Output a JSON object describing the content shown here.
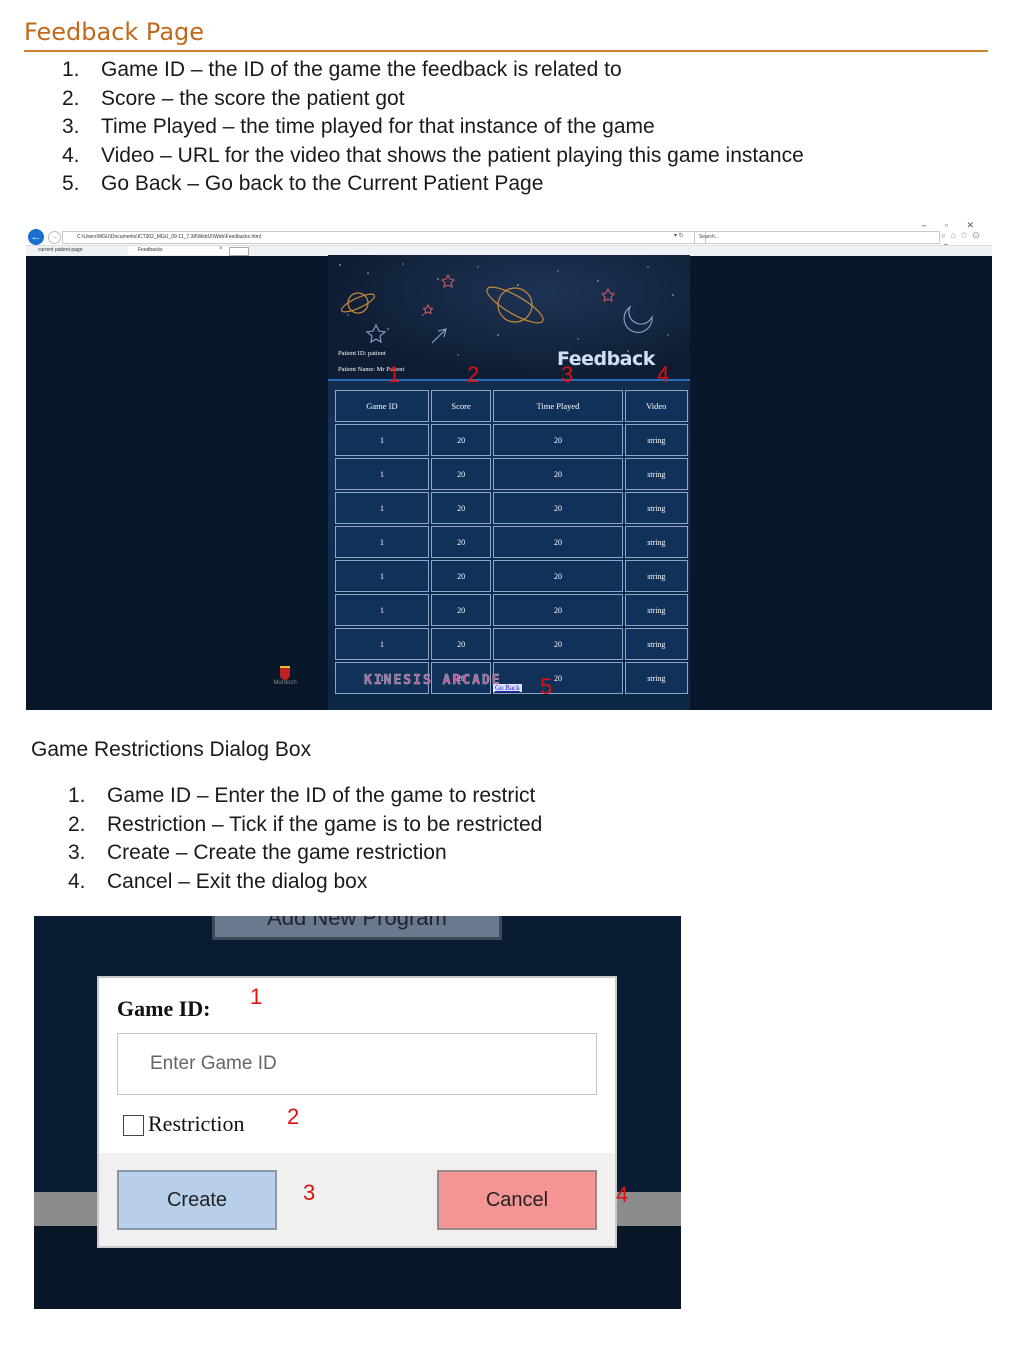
{
  "section1": {
    "title": "Feedback Page",
    "items": [
      {
        "num": "1.",
        "text": "Game ID – the ID of the game the feedback is related to"
      },
      {
        "num": "2.",
        "text": "Score – the score the patient got"
      },
      {
        "num": "3.",
        "text": "Time Played – the time played for that instance of the game"
      },
      {
        "num": "4.",
        "text": "Video – URL for the video that shows the patient playing this game instance"
      },
      {
        "num": "5.",
        "text": "Go Back – Go back to the Current Patient Page"
      }
    ]
  },
  "browser": {
    "address": "C:\\Users\\MGU\\Documents\\ICT302_MGU_09-11_7.38\\WebUI\\Web\\Feedbacks.html",
    "search_placeholder": "Search...",
    "tabs": [
      "current patient page",
      "Feedbacks"
    ],
    "patient_id": "Patient ID: patient",
    "patient_name": "Patient Name: Mr Patient",
    "page_title": "Feedback",
    "headers": [
      "Game ID",
      "Score",
      "Time Played",
      "Video"
    ],
    "rows": [
      [
        "1",
        "20",
        "20",
        "string"
      ],
      [
        "1",
        "20",
        "20",
        "string"
      ],
      [
        "1",
        "20",
        "20",
        "string"
      ],
      [
        "1",
        "20",
        "20",
        "string"
      ],
      [
        "1",
        "20",
        "20",
        "string"
      ],
      [
        "1",
        "20",
        "20",
        "string"
      ],
      [
        "1",
        "20",
        "20",
        "string"
      ],
      [
        "1",
        "20",
        "20",
        "string"
      ]
    ],
    "go_back": "Go Back",
    "logo_text": "KINESIS ARCADE",
    "university": "Murdoch"
  },
  "annotations1": [
    "1",
    "2",
    "3",
    "4",
    "5"
  ],
  "section2": {
    "title": "Game Restrictions Dialog Box",
    "items": [
      {
        "num": "1.",
        "text": "Game ID – Enter the ID of the game to restrict"
      },
      {
        "num": "2.",
        "text": "Restriction – Tick if the game is to be restricted"
      },
      {
        "num": "3.",
        "text": "Create – Create the game restriction"
      },
      {
        "num": "4.",
        "text": "Cancel – Exit the dialog box"
      }
    ]
  },
  "dialog": {
    "background_button": "Add New Program",
    "game_id_label": "Game ID:",
    "game_id_placeholder": "Enter Game ID",
    "restriction_label": "Restriction",
    "create_label": "Create",
    "cancel_label": "Cancel"
  },
  "annotations2": [
    "1",
    "2",
    "3",
    "4"
  ]
}
